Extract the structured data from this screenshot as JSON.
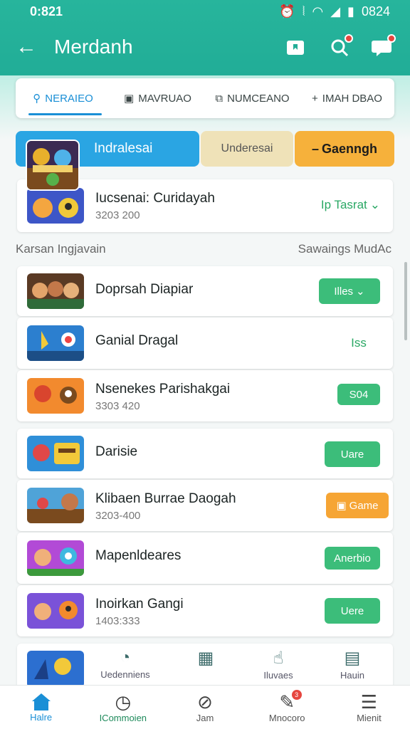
{
  "status": {
    "time": "0:821",
    "right_time": "0824"
  },
  "header": {
    "title": "Merdanh"
  },
  "tabs": [
    {
      "label": "NERAIEO",
      "icon": "search-icon"
    },
    {
      "label": "MAVRUAO",
      "icon": "monitor-icon"
    },
    {
      "label": "NUMCEANO",
      "icon": "image-icon"
    },
    {
      "label": "IMAH DBAO",
      "icon": "plus-icon"
    }
  ],
  "segments": {
    "primary": "Indralesai",
    "secondary": "Underesai",
    "action": "Gaenngh"
  },
  "featured": {
    "name": "Iucsenai: Curidayah",
    "sub": "3203 200",
    "action": "Ip Tasrat"
  },
  "section": {
    "left": "Karsan Ingjavain",
    "right": "Sawaings MudAc"
  },
  "apps": [
    {
      "name": "Doprsah Diapiar",
      "sub": "",
      "button": "Illes"
    },
    {
      "name": "Ganial Dragal",
      "sub": "",
      "button": "Iss"
    },
    {
      "name": "Nsenekes Parishakgai",
      "sub": "3303 420",
      "button": "S04"
    },
    {
      "name": "Darisie",
      "sub": "",
      "button": "Uare"
    },
    {
      "name": "Klibaen Burrae Daogah",
      "sub": "3203-400",
      "button": "Game"
    },
    {
      "name": "Mapenldeares",
      "sub": "",
      "button": "Anerbio"
    },
    {
      "name": "Inoirkan Gangi",
      "sub": "1403:333",
      "button": "Uere"
    }
  ],
  "dock": [
    {
      "label": "Uedenniens",
      "icon": "timer-icon"
    },
    {
      "label": "",
      "icon": "table-icon"
    },
    {
      "label": "Iluvaes",
      "icon": "thumb-icon"
    },
    {
      "label": "Hauin",
      "icon": "clipboard-icon"
    }
  ],
  "nav": [
    {
      "label": "Halre",
      "icon": "home-icon"
    },
    {
      "label": "ICommoien",
      "icon": "clock-icon"
    },
    {
      "label": "Jam",
      "icon": "compass-icon"
    },
    {
      "label": "Mnocoro",
      "icon": "edit-icon",
      "badge": "3"
    },
    {
      "label": "Mienit",
      "icon": "menu-icon"
    }
  ]
}
